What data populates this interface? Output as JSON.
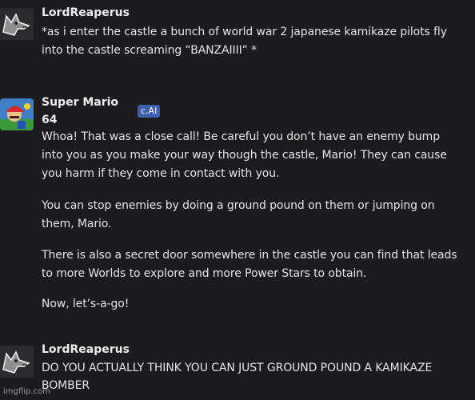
{
  "messages": [
    {
      "author": "LordReaperus",
      "avatar_icon": "wolf-avatar-icon",
      "lines": [
        "*as i enter the castle a bunch of world war 2 japanese kamikaze pilots fly",
        "into the castle screaming “BANZAIIII” *"
      ]
    },
    {
      "author_line1": "Super Mario",
      "author_line2": "64",
      "badge": "c.AI",
      "avatar_icon": "mario-avatar-icon",
      "paragraphs": [
        [
          "Whoa! That was a close call! Be careful you don’t have an enemy bump",
          "into you as you make your way though the castle, Mario! They can cause",
          "you harm if they come in contact with you."
        ],
        [
          "You can stop enemies by doing a ground pound on them or jumping on",
          "them, Mario."
        ],
        [
          "There is also a secret door somewhere in the castle you can find that leads",
          "to more Worlds to explore and more Power Stars to obtain."
        ],
        [
          "Now, let’s-a-go!"
        ]
      ]
    },
    {
      "author": "LordReaperus",
      "avatar_icon": "wolf-avatar-icon",
      "lines": [
        "DO YOU ACTUALLY THINK YOU CAN JUST GROUND POUND A KAMIKAZE",
        "BOMBER"
      ]
    }
  ],
  "watermark": "imgflip.com",
  "colors": {
    "background": "#1c1c1e",
    "text": "#e4e4e4",
    "badge": "#3f5fb0"
  }
}
